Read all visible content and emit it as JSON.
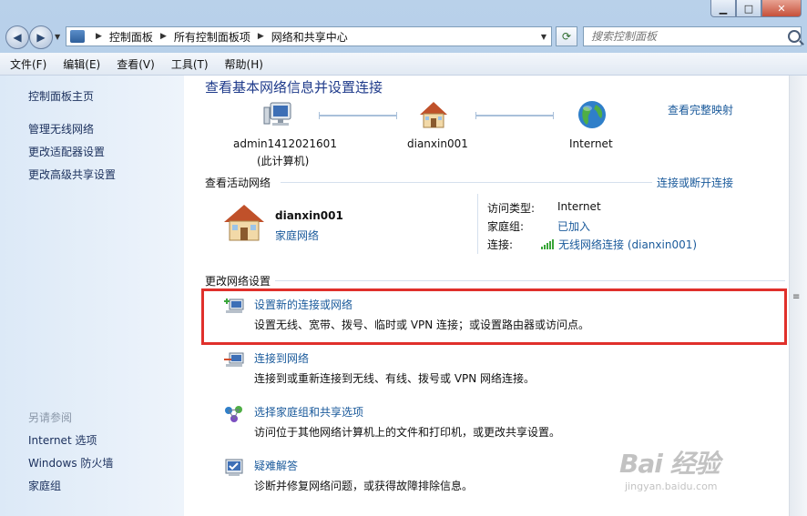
{
  "address_bar": {
    "crumbs": [
      "控制面板",
      "所有控制面板项",
      "网络和共享中心"
    ]
  },
  "search": {
    "placeholder": "搜索控制面板"
  },
  "menu": [
    "文件(F)",
    "编辑(E)",
    "查看(V)",
    "工具(T)",
    "帮助(H)"
  ],
  "sidebar": {
    "links": [
      "控制面板主页",
      "管理无线网络",
      "更改适配器设置",
      "更改高级共享设置"
    ],
    "see_also_title": "另请参阅",
    "see_also": [
      "Internet 选项",
      "Windows 防火墙",
      "家庭组"
    ]
  },
  "main": {
    "title": "查看基本网络信息并设置连接",
    "map_link": "查看完整映射",
    "nodes": [
      {
        "line1": "admin1412021601",
        "line2": "(此计算机)"
      },
      {
        "line1": "dianxin001",
        "line2": ""
      },
      {
        "line1": "Internet",
        "line2": ""
      }
    ],
    "active_networks": {
      "title": "查看活动网络",
      "connect_link": "连接或断开连接",
      "name": "dianxin001",
      "type": "家庭网络",
      "props": [
        {
          "label": "访问类型:",
          "value": "Internet"
        },
        {
          "label": "家庭组:",
          "value": "已加入"
        },
        {
          "label": "连接:",
          "value": "无线网络连接 (dianxin001)"
        }
      ]
    },
    "change_settings": {
      "title": "更改网络设置",
      "tasks": [
        {
          "link": "设置新的连接或网络",
          "desc": "设置无线、宽带、拨号、临时或 VPN 连接；或设置路由器或访问点。"
        },
        {
          "link": "连接到网络",
          "desc": "连接到或重新连接到无线、有线、拨号或 VPN 网络连接。"
        },
        {
          "link": "选择家庭组和共享选项",
          "desc": "访问位于其他网络计算机上的文件和打印机，或更改共享设置。"
        },
        {
          "link": "疑难解答",
          "desc": "诊断并修复网络问题，或获得故障排除信息。"
        }
      ]
    }
  },
  "watermark": {
    "main": "Bai 经验",
    "sub": "jingyan.baidu.com"
  },
  "colors": {
    "link": "#1a5a9b",
    "highlight_box": "#e0302b",
    "title": "#1e3a8a"
  }
}
